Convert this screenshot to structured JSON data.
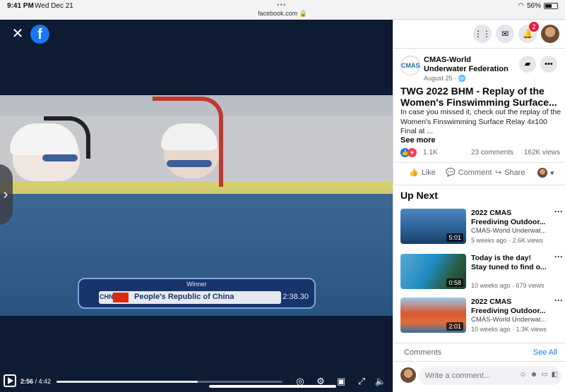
{
  "status_bar": {
    "time": "9:41 PM",
    "date": "Wed Dec 21",
    "url": "facebook.com",
    "battery_text": "56%",
    "battery_level": 0.56
  },
  "video": {
    "caption_winner": "Winner",
    "caption_code": "CHN",
    "caption_country": "People's Republic of China",
    "caption_time": "2:38.30",
    "current_time": "2:56",
    "total_time": "4:42",
    "progress": 0.624
  },
  "panel": {
    "notification_count": "2",
    "page_name": "CMAS-World Underwater Federation",
    "page_logo_text": "CMAS",
    "post_date": "August 25 · ",
    "post_title": "TWG 2022 BHM - Replay of the Women's Finswimming Surface...",
    "post_body": "In case you missed it, check out the replay of the Women's Finswimming Surface Relay 4x100 Final at ...",
    "see_more": "See more",
    "reaction_count": "1.1K",
    "comments_count": "23 comments",
    "views_count": "162K views",
    "actions": {
      "like": "Like",
      "comment": "Comment",
      "share": "Share"
    },
    "up_next_heading": "Up Next",
    "up_next": [
      {
        "title": "2022 CMAS Freediving Outdoor...",
        "page": "CMAS-World Underwat...",
        "meta": "5 weeks ago · 2.6K views",
        "duration": "5:01"
      },
      {
        "title_line1": "Today is the day!",
        "title_line2": "Stay tuned to find o...",
        "page": "",
        "meta": "10 weeks ago · 679 views",
        "duration": "0:58"
      },
      {
        "title": "2022 CMAS Freediving Outdoor...",
        "page": "CMAS-World Underwat...",
        "meta": "10 weeks ago · 1.3K views",
        "duration": "2:01"
      }
    ],
    "comments_label": "Comments",
    "see_all": "See All",
    "comment_placeholder": "Write a comment..."
  }
}
